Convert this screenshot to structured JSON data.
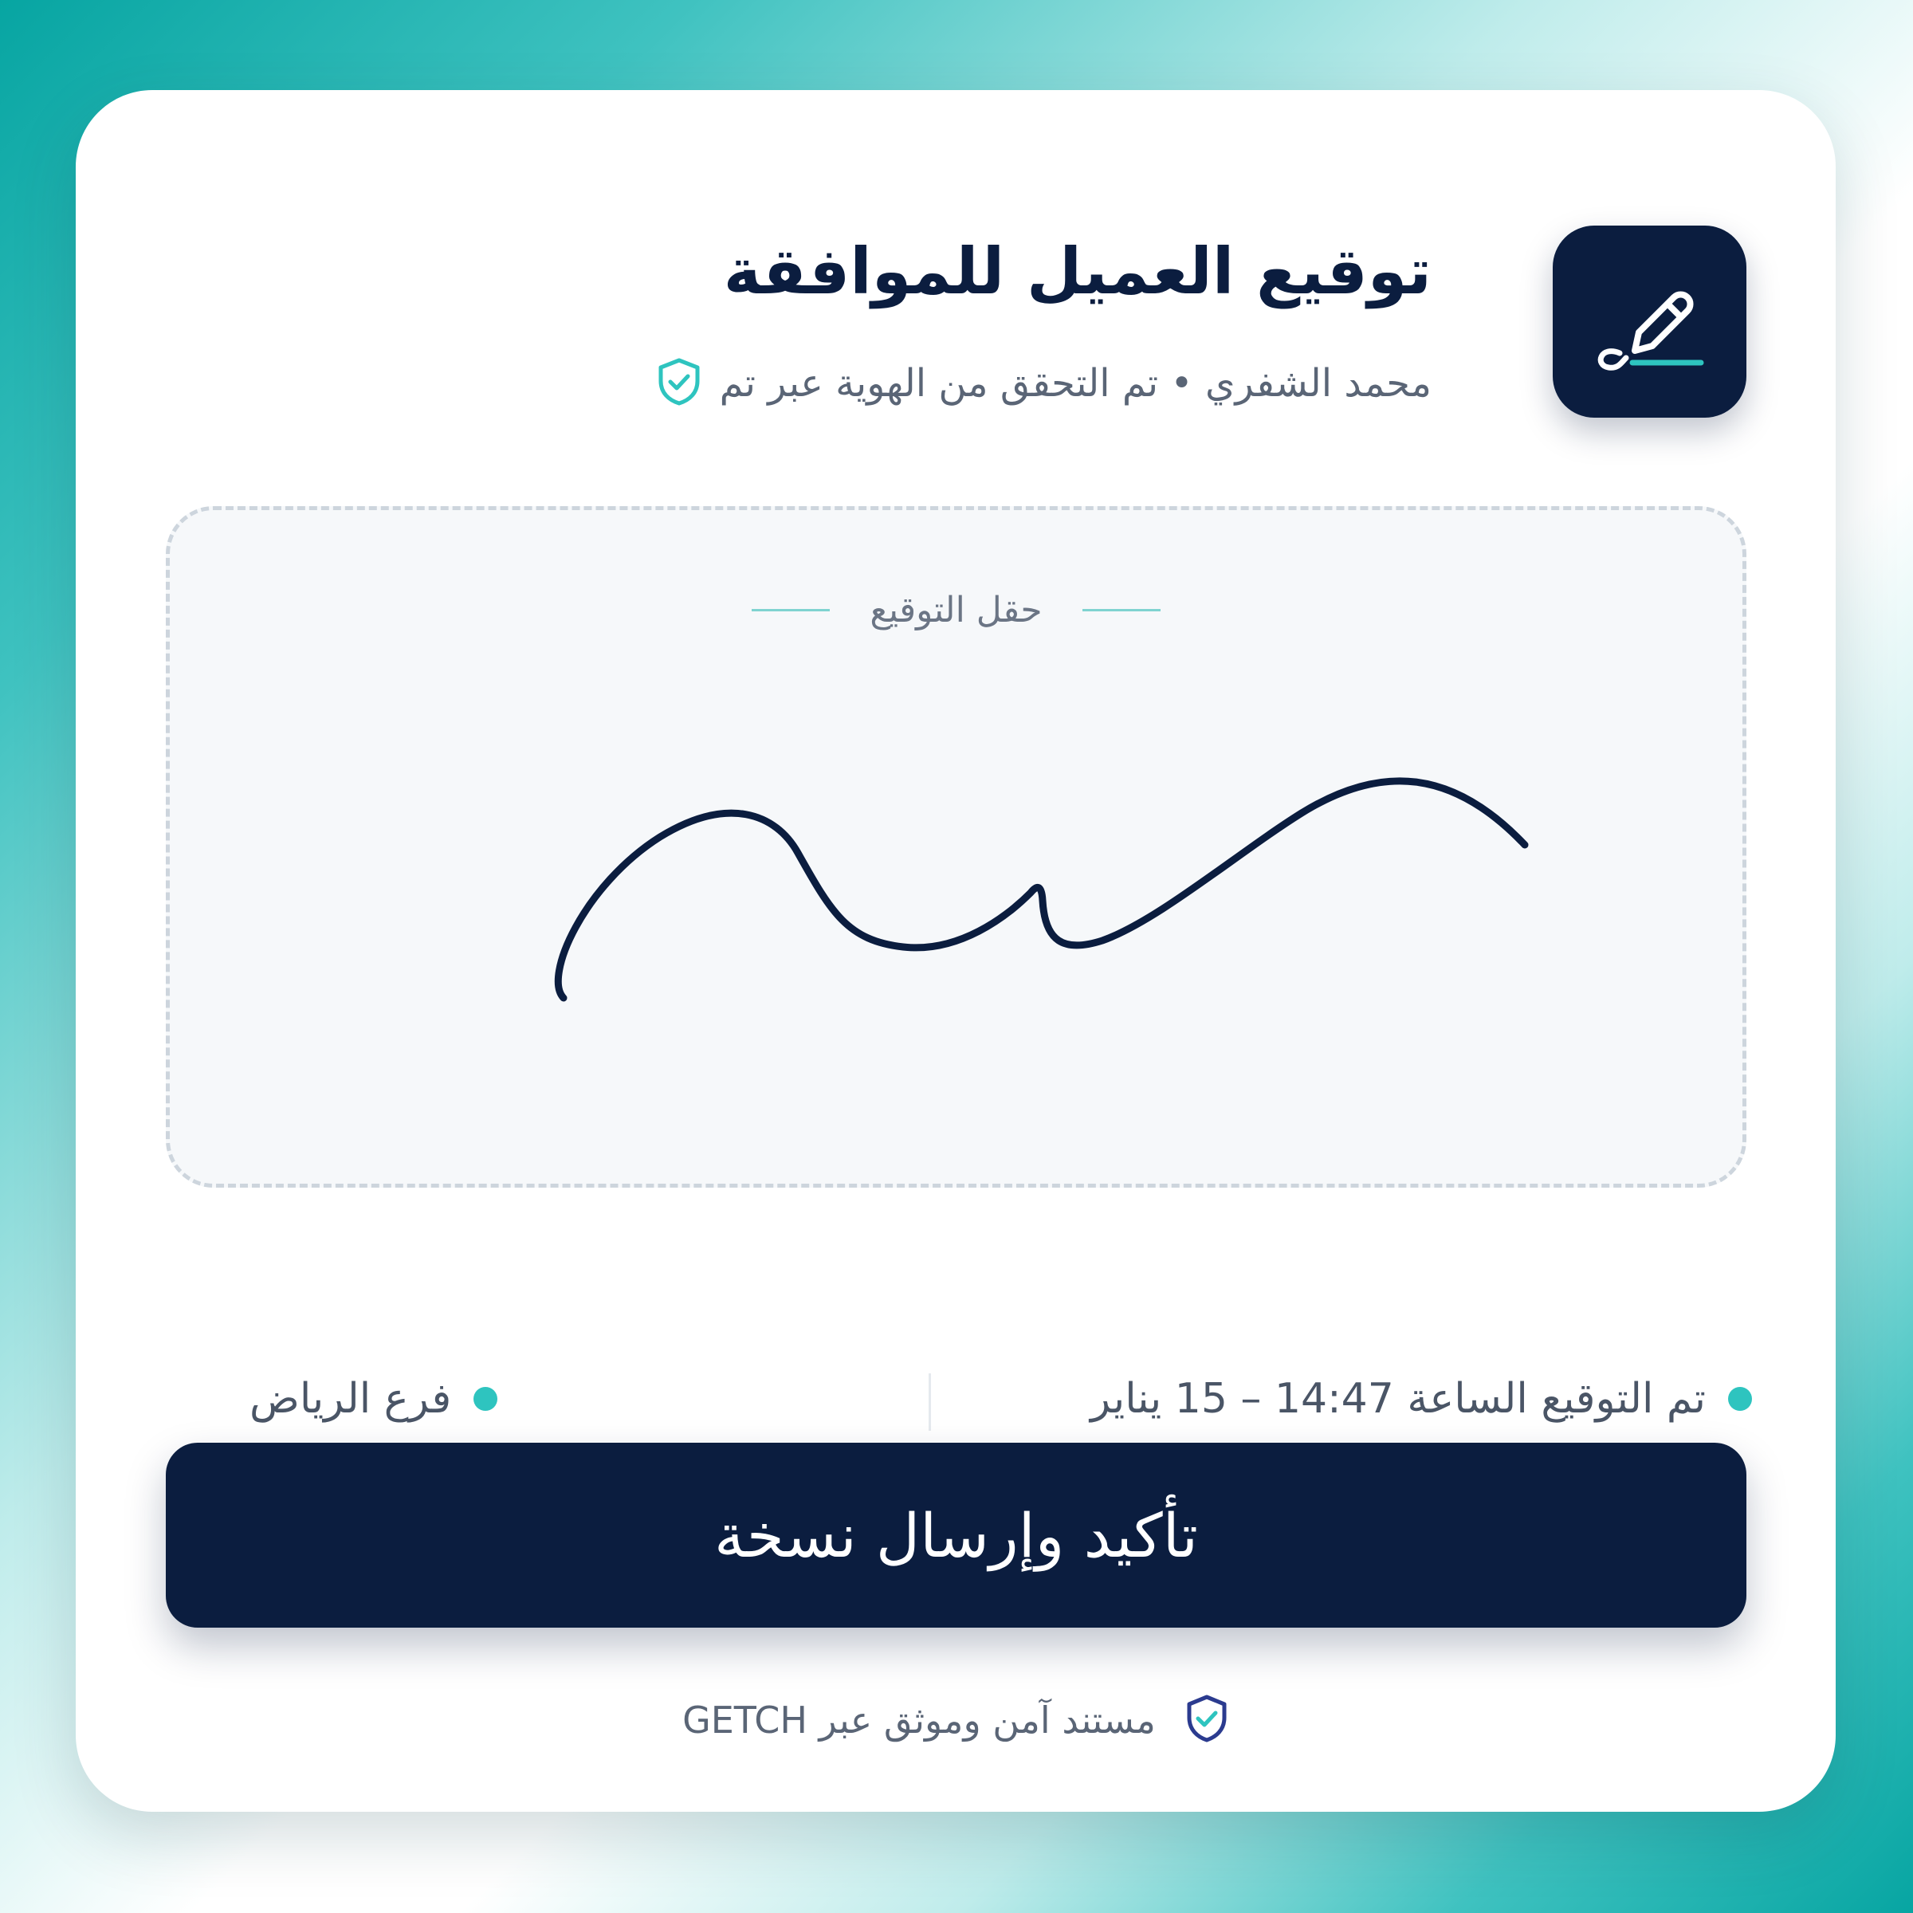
{
  "header": {
    "icon": "signature-pen-icon",
    "title": "توقيع العميل للموافقة",
    "subtitle": "محمد الشفري • تم التحقق من الهوية عبر تم",
    "verified_icon": "shield-check-icon"
  },
  "signature_field": {
    "label": "حقل التوقيع"
  },
  "meta": {
    "signed_at": "تم التوقيع الساعة 14:47 – 15 يناير",
    "branch": "فرع الرياض"
  },
  "actions": {
    "confirm_label": "تأكيد وإرسال نسخة"
  },
  "footer": {
    "text": "مستند آمن وموثق عبر GETCH",
    "icon": "shield-check-icon"
  },
  "colors": {
    "primary": "#0b1d3f",
    "accent": "#2ec4bf"
  }
}
